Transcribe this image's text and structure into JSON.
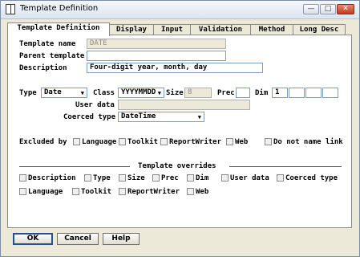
{
  "window": {
    "title": "Template Definition",
    "minimize": "—",
    "maximize": "□",
    "close": "✕"
  },
  "tabs": [
    {
      "label": "Template Definition"
    },
    {
      "label": "Display"
    },
    {
      "label": "Input"
    },
    {
      "label": "Validation"
    },
    {
      "label": "Method"
    },
    {
      "label": "Long Desc"
    }
  ],
  "form": {
    "template_name_label": "Template name",
    "template_name_value": "DATE",
    "parent_template_label": "Parent template",
    "parent_template_value": "",
    "description_label": "Description",
    "description_value": "Four-digit year, month, day",
    "type_label": "Type",
    "type_value": "Date",
    "class_label": "Class",
    "class_value": "YYYYMMDD",
    "size_label": "Size",
    "size_value": "8",
    "prec_label": "Prec",
    "prec_value": "",
    "dim_label": "Dim",
    "dim_value": "1",
    "user_data_label": "User data",
    "user_data_value": "",
    "coerced_type_label": "Coerced type",
    "coerced_type_value": "DateTime"
  },
  "excluded": {
    "label": "Excluded by",
    "items": [
      "Language",
      "Toolkit",
      "ReportWriter",
      "Web",
      "Do not name link"
    ]
  },
  "overrides": {
    "title": "Template overrides",
    "row1": [
      "Description",
      "Type",
      "Size",
      "Prec",
      "Dim",
      "User data",
      "Coerced type"
    ],
    "row2": [
      "Language",
      "Toolkit",
      "ReportWriter",
      "Web"
    ]
  },
  "buttons": {
    "ok": "OK",
    "cancel": "Cancel",
    "help": "Help"
  }
}
